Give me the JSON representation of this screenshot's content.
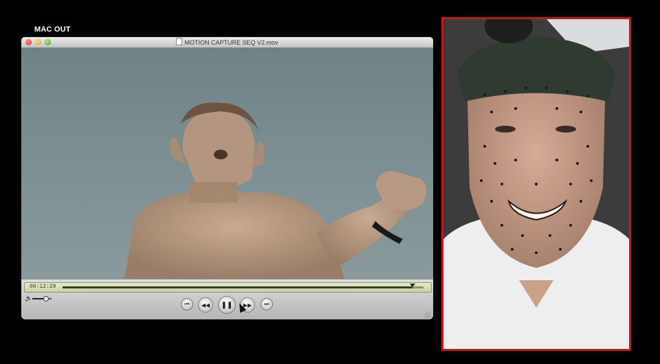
{
  "overlay": {
    "label": "MAC OUT"
  },
  "player": {
    "window_title": "MOTION CAPTURE SEQ V2.mov",
    "timecode": "00:12:29",
    "progress": 0.97,
    "volume": 0.7,
    "buttons": {
      "go_to_start": "⏮",
      "rewind": "◀◀",
      "pause": "❚❚",
      "fast_forward": "▶▶",
      "go_to_end": "⏭"
    }
  },
  "colors": {
    "facecam_border": "#c4161c",
    "scrubber": "#dde3bb",
    "background": "#000000"
  }
}
